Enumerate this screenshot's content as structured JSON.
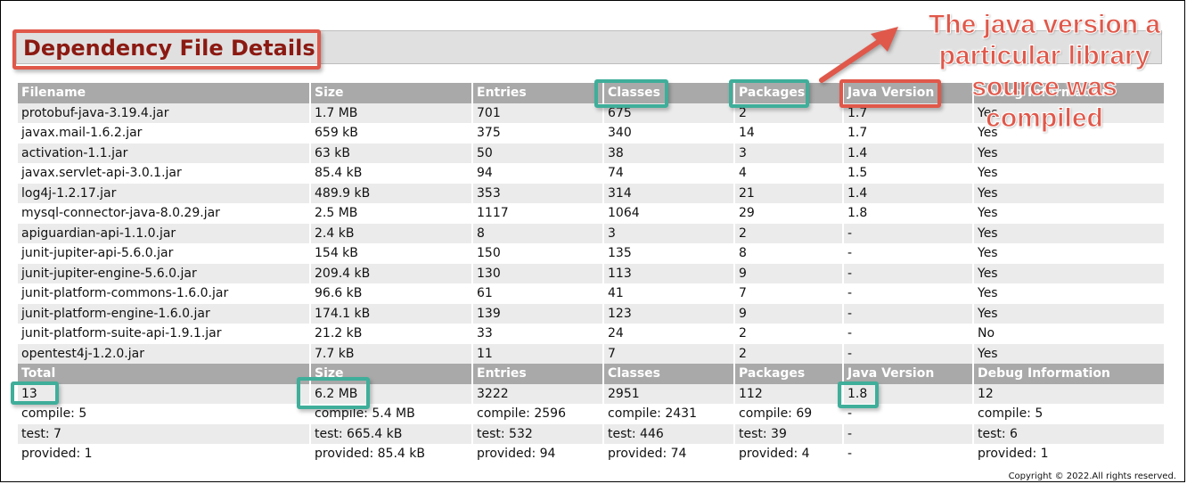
{
  "report": {
    "title": "Dependency File Details",
    "copyright": "Copyright © 2022.All rights reserved."
  },
  "callout": {
    "line1": "The java version a",
    "line2": "particular library",
    "line3": "source was",
    "line4": "compiled"
  },
  "colors": {
    "annotation_red": "#e0584a",
    "annotation_green": "#3fae9a",
    "title_color": "#8b1a12",
    "header_bg": "#a9a9a9"
  },
  "table": {
    "headers": [
      "Filename",
      "Size",
      "Entries",
      "Classes",
      "Packages",
      "Java Version",
      "Debug Information"
    ],
    "rows": [
      [
        "protobuf-java-3.19.4.jar",
        "1.7 MB",
        "701",
        "675",
        "2",
        "1.7",
        "Yes"
      ],
      [
        "javax.mail-1.6.2.jar",
        "659 kB",
        "375",
        "340",
        "14",
        "1.7",
        "Yes"
      ],
      [
        "activation-1.1.jar",
        "63 kB",
        "50",
        "38",
        "3",
        "1.4",
        "Yes"
      ],
      [
        "javax.servlet-api-3.0.1.jar",
        "85.4 kB",
        "94",
        "74",
        "4",
        "1.5",
        "Yes"
      ],
      [
        "log4j-1.2.17.jar",
        "489.9 kB",
        "353",
        "314",
        "21",
        "1.4",
        "Yes"
      ],
      [
        "mysql-connector-java-8.0.29.jar",
        "2.5 MB",
        "1117",
        "1064",
        "29",
        "1.8",
        "Yes"
      ],
      [
        "apiguardian-api-1.1.0.jar",
        "2.4 kB",
        "8",
        "3",
        "2",
        "-",
        "Yes"
      ],
      [
        "junit-jupiter-api-5.6.0.jar",
        "154 kB",
        "150",
        "135",
        "8",
        "-",
        "Yes"
      ],
      [
        "junit-jupiter-engine-5.6.0.jar",
        "209.4 kB",
        "130",
        "113",
        "9",
        "-",
        "Yes"
      ],
      [
        "junit-platform-commons-1.6.0.jar",
        "96.6 kB",
        "61",
        "41",
        "7",
        "-",
        "Yes"
      ],
      [
        "junit-platform-engine-1.6.0.jar",
        "174.1 kB",
        "139",
        "123",
        "9",
        "-",
        "Yes"
      ],
      [
        "junit-platform-suite-api-1.9.1.jar",
        "21.2 kB",
        "33",
        "24",
        "2",
        "-",
        "No"
      ],
      [
        "opentest4j-1.2.0.jar",
        "7.7 kB",
        "11",
        "7",
        "2",
        "-",
        "Yes"
      ]
    ],
    "total_headers": [
      "Total",
      "Size",
      "Entries",
      "Classes",
      "Packages",
      "Java Version",
      "Debug Information"
    ],
    "total_rows": [
      [
        "13",
        "6.2 MB",
        "3222",
        "2951",
        "112",
        "1.8",
        "12"
      ],
      [
        "compile: 5",
        "compile: 5.4 MB",
        "compile: 2596",
        "compile: 2431",
        "compile: 69",
        "-",
        "compile: 5"
      ],
      [
        "test: 7",
        "test: 665.4 kB",
        "test: 532",
        "test: 446",
        "test: 39",
        "-",
        "test: 6"
      ],
      [
        "provided: 1",
        "provided: 85.4 kB",
        "provided: 94",
        "provided: 74",
        "provided: 4",
        "-",
        "provided: 1"
      ]
    ]
  }
}
